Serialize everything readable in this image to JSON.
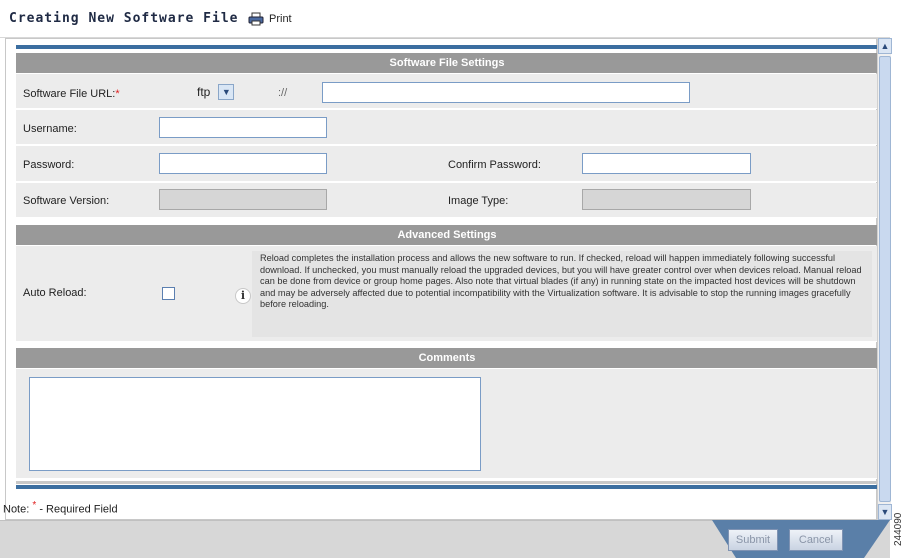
{
  "header": {
    "title": "Creating New Software File",
    "print_label": "Print"
  },
  "sections": {
    "software": "Software File Settings",
    "advanced": "Advanced Settings",
    "comments": "Comments"
  },
  "fields": {
    "url_label": "Software File URL:",
    "protocol_value": "ftp",
    "url_separator": "://",
    "username_label": "Username:",
    "password_label": "Password:",
    "confirm_password_label": "Confirm Password:",
    "software_version_label": "Software Version:",
    "image_type_label": "Image Type:",
    "auto_reload_label": "Auto Reload:",
    "required_marker": "*"
  },
  "auto_reload": {
    "checked": false,
    "description": "Reload completes the installation process and allows the new software to run. If checked, reload will happen immediately following successful download. If unchecked, you must manually reload the upgraded devices, but you will have greater control over when devices reload. Manual reload can be done from device or group home pages. Also note that virtual blades (if any) in running state on the impacted host devices will be shutdown and may be adversely affected due to potential incompatibility with the Virtualization software. It is advisable to stop the running images gracefully before reloading."
  },
  "note": {
    "prefix": "Note: ",
    "marker": "*",
    "text": " - Required Field"
  },
  "footer": {
    "submit_label": "Submit",
    "cancel_label": "Cancel"
  },
  "side_label": "244090",
  "colors": {
    "header_bar": "#999999",
    "stripe": "#3b6ea0",
    "footer_tab": "#5a7fa8",
    "required": "#e02020"
  }
}
